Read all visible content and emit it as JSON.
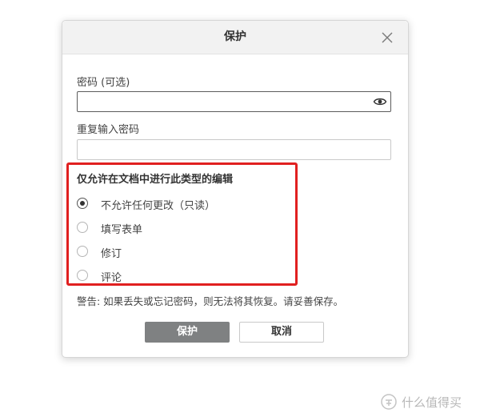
{
  "dialog": {
    "title": "保护",
    "close_icon": "close-icon"
  },
  "password": {
    "label": "密码 (可选)",
    "value": "",
    "toggle_icon": "eye-icon"
  },
  "repeat_password": {
    "label": "重复输入密码",
    "value": ""
  },
  "editing": {
    "title": "仅允许在文档中进行此类型的编辑",
    "options": [
      {
        "label": "不允许任何更改（只读）",
        "checked": true
      },
      {
        "label": "填写表单",
        "checked": false
      },
      {
        "label": "修订",
        "checked": false
      },
      {
        "label": "评论",
        "checked": false
      }
    ]
  },
  "warning": "警告: 如果丢失或忘记密码，则无法将其恢复。请妥善保存。",
  "buttons": {
    "protect": "保护",
    "cancel": "取消"
  },
  "colors": {
    "highlight": "#e02020",
    "primary_button": "#7f8182"
  },
  "watermark": {
    "text": "什么值得买"
  }
}
